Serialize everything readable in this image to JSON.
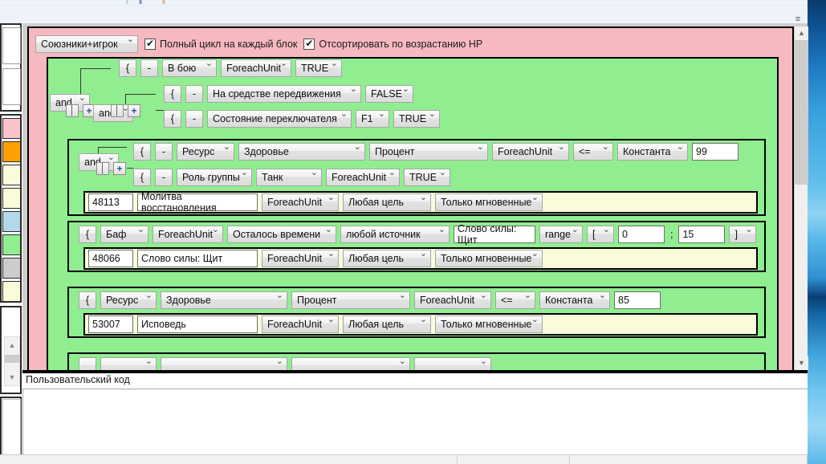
{
  "header": {
    "target_select": "Союзники+игрок",
    "checkbox_full_cycle": "Полный цикл на каждый блок",
    "checkbox_sort_hp": "Отсортировать по возрастанию HP"
  },
  "condition_tree": {
    "operator_outer": "and",
    "operator_inner": "and",
    "brace": "{",
    "minus": "-",
    "rows": [
      {
        "type": "В бою",
        "scope": "ForeachUnit",
        "value": "TRUE"
      },
      {
        "type": "На средстве передвижения",
        "value": "FALSE"
      },
      {
        "type": "Состояние переключателя",
        "key": "F1",
        "value": "TRUE"
      }
    ]
  },
  "blocks": [
    {
      "operator": "and",
      "brace": "{",
      "minus": "-",
      "conditions": [
        {
          "kind": "Ресурс",
          "resource": "Здоровье",
          "mode": "Процент",
          "scope": "ForeachUnit",
          "comparator": "<=",
          "operand": "Константа",
          "number": "99"
        },
        {
          "kind": "Роль группы",
          "role": "Танк",
          "scope": "ForeachUnit",
          "value": "TRUE"
        }
      ],
      "action": {
        "id": "48113",
        "name": "Молитва восстановления",
        "scope": "ForeachUnit",
        "target": "Любая цель",
        "cast": "Только мгновенные"
      }
    },
    {
      "brace": "{",
      "conditions": [
        {
          "kind": "Баф",
          "scope": "ForeachUnit",
          "mode": "Осталось времени",
          "source": "любой источник",
          "aura": "Слово силы: Щит",
          "comparator": "range",
          "bracket_open": "[",
          "range_min": "0",
          "range_sep": ";",
          "range_max": "15",
          "bracket_close": "]"
        }
      ],
      "action": {
        "id": "48066",
        "name": "Слово силы: Щит",
        "scope": "ForeachUnit",
        "target": "Любая цель",
        "cast": "Только мгновенные"
      }
    },
    {
      "brace": "{",
      "conditions": [
        {
          "kind": "Ресурс",
          "resource": "Здоровье",
          "mode": "Процент",
          "scope": "ForeachUnit",
          "comparator": "<=",
          "operand": "Константа",
          "number": "85"
        }
      ],
      "action": {
        "id": "53007",
        "name": "Исповедь",
        "scope": "ForeachUnit",
        "target": "Любая цель",
        "cast": "Только мгновенные"
      }
    }
  ],
  "footer": {
    "code_label": "Пользовательский код"
  },
  "palette": {
    "swatches": [
      "#f9c3cc",
      "#ffa000",
      "#fbfbdc",
      "#fbfbdc",
      "#b2d8ea",
      "#90ee90",
      "#cccccc",
      "#fbfbdc"
    ],
    "block_green": "#90ee90",
    "container_pink": "#f7b9c0",
    "action_cream": "#fbfbdc"
  }
}
